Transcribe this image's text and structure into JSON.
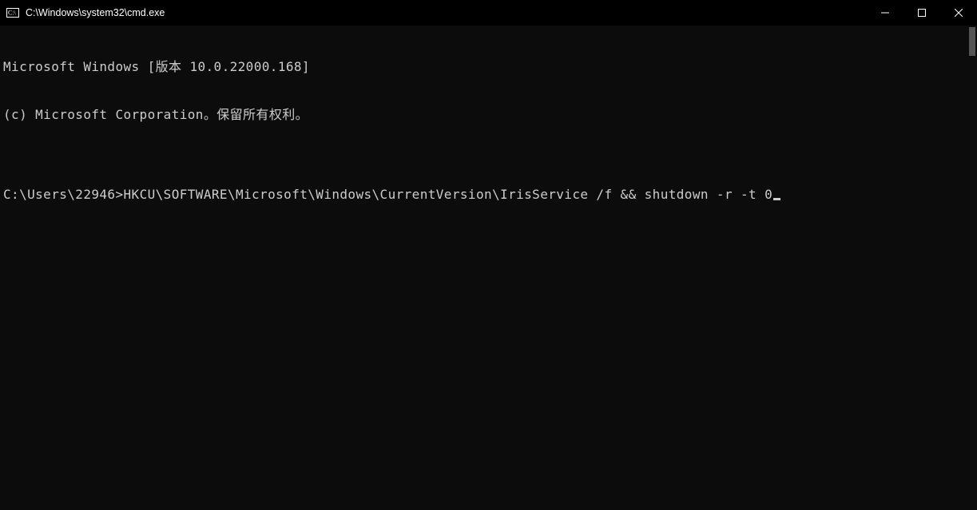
{
  "window": {
    "title": "C:\\Windows\\system32\\cmd.exe"
  },
  "controls": {
    "minimize": "minimize",
    "maximize": "maximize",
    "close": "close"
  },
  "terminal": {
    "line1": "Microsoft Windows [版本 10.0.22000.168]",
    "line2": "(c) Microsoft Corporation。保留所有权利。",
    "blank": "",
    "prompt": "C:\\Users\\22946>",
    "command": "HKCU\\SOFTWARE\\Microsoft\\Windows\\CurrentVersion\\IrisService /f && shutdown -r -t 0"
  }
}
